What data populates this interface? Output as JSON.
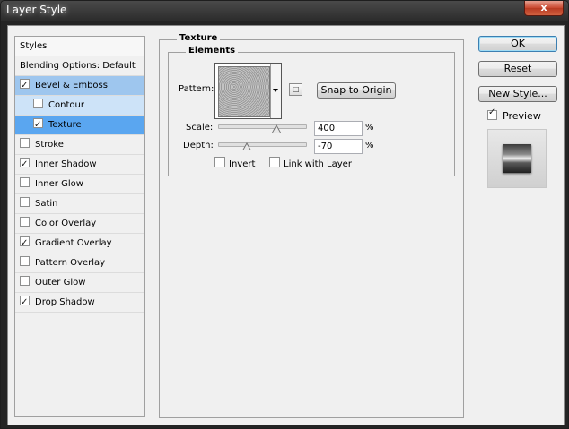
{
  "window": {
    "title": "Layer Style",
    "close_label": "x"
  },
  "styles": {
    "header": "Styles",
    "items": [
      {
        "label": "Blending Options: Default",
        "checkbox": false,
        "checked": false
      },
      {
        "label": "Bevel & Emboss",
        "checkbox": true,
        "checked": true
      },
      {
        "label": "Contour",
        "checkbox": true,
        "checked": false
      },
      {
        "label": "Texture",
        "checkbox": true,
        "checked": true
      },
      {
        "label": "Stroke",
        "checkbox": true,
        "checked": false
      },
      {
        "label": "Inner Shadow",
        "checkbox": true,
        "checked": true
      },
      {
        "label": "Inner Glow",
        "checkbox": true,
        "checked": false
      },
      {
        "label": "Satin",
        "checkbox": true,
        "checked": false
      },
      {
        "label": "Color Overlay",
        "checkbox": true,
        "checked": false
      },
      {
        "label": "Gradient Overlay",
        "checkbox": true,
        "checked": true
      },
      {
        "label": "Pattern Overlay",
        "checkbox": true,
        "checked": false
      },
      {
        "label": "Outer Glow",
        "checkbox": true,
        "checked": false
      },
      {
        "label": "Drop Shadow",
        "checkbox": true,
        "checked": true
      }
    ]
  },
  "texture": {
    "group_title": "Texture",
    "elements_title": "Elements",
    "pattern_label": "Pattern:",
    "snap_button": "Snap to Origin",
    "scale_label": "Scale:",
    "scale_value": "400",
    "scale_unit": "%",
    "scale_slider_position": 0.67,
    "depth_label": "Depth:",
    "depth_value": "-70",
    "depth_unit": "%",
    "depth_slider_position": 0.33,
    "invert_label": "Invert",
    "invert_checked": false,
    "link_label": "Link with Layer",
    "link_checked": false
  },
  "buttons": {
    "ok": "OK",
    "reset": "Reset",
    "new_style": "New Style..."
  },
  "preview": {
    "label": "Preview",
    "checked": true
  }
}
